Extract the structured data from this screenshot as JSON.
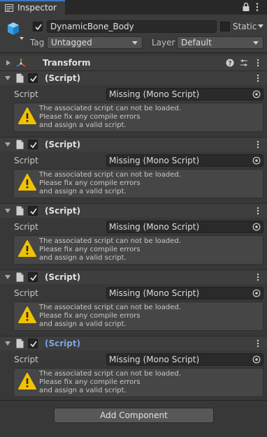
{
  "tab": {
    "label": "Inspector"
  },
  "header": {
    "name": "DynamicBone_Body",
    "active_checked": true,
    "static_label": "Static",
    "tag_label": "Tag",
    "tag_value": "Untagged",
    "layer_label": "Layer",
    "layer_value": "Default"
  },
  "transform": {
    "title": "Transform"
  },
  "components": [
    {
      "title": "(Script)",
      "field_label": "Script",
      "field_value": "Missing (Mono Script)",
      "message": [
        "The associated script can not be loaded.",
        "Please fix any compile errors",
        "and assign a valid script."
      ]
    },
    {
      "title": "(Script)",
      "field_label": "Script",
      "field_value": "Missing (Mono Script)",
      "message": [
        "The associated script can not be loaded.",
        "Please fix any compile errors",
        "and assign a valid script."
      ]
    },
    {
      "title": "(Script)",
      "field_label": "Script",
      "field_value": "Missing (Mono Script)",
      "message": [
        "The associated script can not be loaded.",
        "Please fix any compile errors",
        "and assign a valid script."
      ]
    },
    {
      "title": "(Script)",
      "field_label": "Script",
      "field_value": "Missing (Mono Script)",
      "message": [
        "The associated script can not be loaded.",
        "Please fix any compile errors",
        "and assign a valid script."
      ]
    },
    {
      "title": "(Script)",
      "field_label": "Script",
      "field_value": "Missing (Mono Script)",
      "message": [
        "The associated script can not be loaded.",
        "Please fix any compile errors",
        "and assign a valid script."
      ]
    }
  ],
  "add_component_label": "Add Component",
  "colors": {
    "accent": "#3a79bb",
    "warning": "#f2c100",
    "selected_title": "#7ba4e3"
  }
}
